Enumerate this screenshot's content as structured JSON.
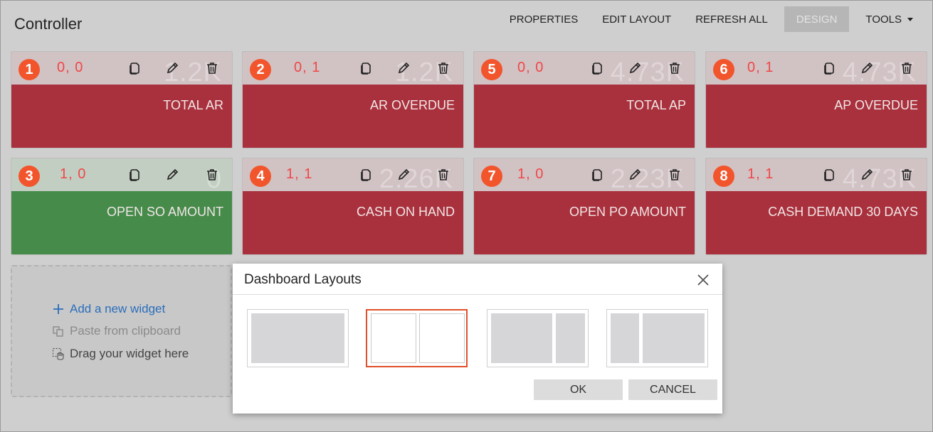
{
  "page": {
    "title": "Controller"
  },
  "toolbar": {
    "properties": "PROPERTIES",
    "edit_layout": "EDIT LAYOUT",
    "refresh_all": "REFRESH ALL",
    "design": "DESIGN",
    "tools": "TOOLS"
  },
  "tiles": [
    {
      "badge": "1",
      "coord": "0, 0",
      "value": "1.2K",
      "label": "TOTAL AR",
      "status": "red"
    },
    {
      "badge": "2",
      "coord": "0, 1",
      "value": "1.2K",
      "label": "AR OVERDUE",
      "status": "red"
    },
    {
      "badge": "5",
      "coord": "0, 0",
      "value": "4.73K",
      "label": "TOTAL AP",
      "status": "red"
    },
    {
      "badge": "6",
      "coord": "0, 1",
      "value": "4.73K",
      "label": "AP OVERDUE",
      "status": "red"
    },
    {
      "badge": "3",
      "coord": "1, 0",
      "value": "0",
      "label": "OPEN SO AMOUNT",
      "status": "green"
    },
    {
      "badge": "4",
      "coord": "1, 1",
      "value": "2.26K",
      "label": "CASH ON HAND",
      "status": "red"
    },
    {
      "badge": "7",
      "coord": "1, 0",
      "value": "2.23K",
      "label": "OPEN PO AMOUNT",
      "status": "red"
    },
    {
      "badge": "8",
      "coord": "1, 1",
      "value": "4.73K",
      "label": "CASH DEMAND 30 DAYS",
      "status": "red"
    }
  ],
  "tile_icons": [
    "copy-icon",
    "pencil-icon",
    "trash-icon"
  ],
  "drop_zone": {
    "add": "Add a new widget",
    "paste": "Paste from clipboard",
    "drag": "Drag your widget here"
  },
  "dialog": {
    "title": "Dashboard Layouts",
    "options": [
      "one-column",
      "two-equal-columns",
      "wide-left-narrow-right",
      "narrow-left-wide-right"
    ],
    "selected": "two-equal-columns",
    "ok": "OK",
    "cancel": "CANCEL"
  },
  "colors": {
    "tile_red": "#a9313d",
    "tile_green": "#478b4b",
    "badge": "#f2552c",
    "coord_text": "#f04747",
    "selected_border": "#e0502a",
    "link_blue": "#2a6ebb"
  }
}
